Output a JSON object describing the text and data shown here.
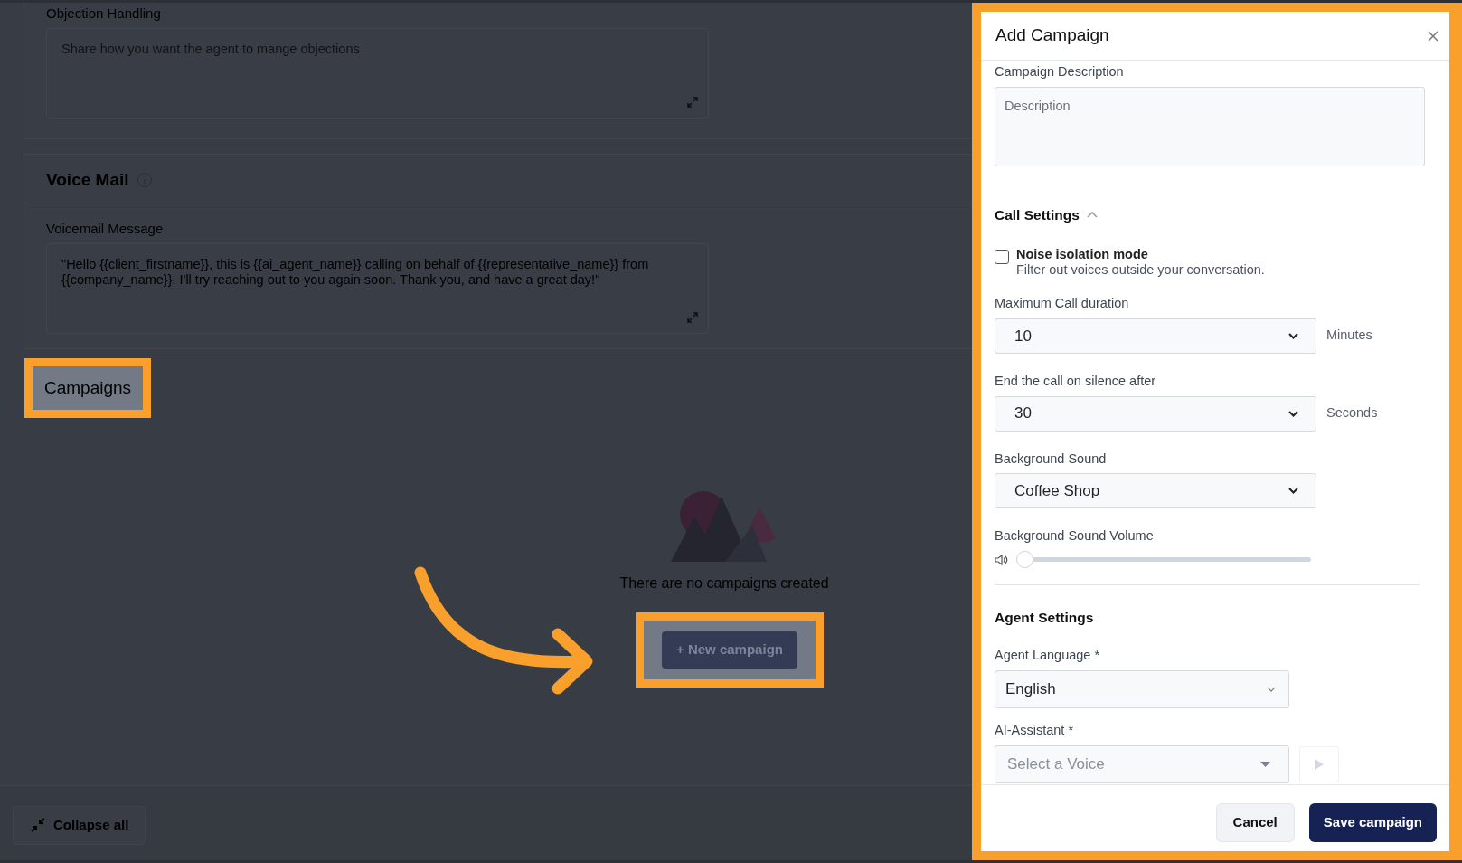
{
  "background_page": {
    "objection_handling": {
      "label": "Objection Handling",
      "placeholder": "Share how you want the agent to mange objections"
    },
    "voice_mail": {
      "title": "Voice Mail",
      "message_label": "Voicemail Message",
      "message": "\"Hello {{client_firstname}}, this is {{ai_agent_name}} calling on behalf of {{representative_name}} from {{company_name}}. I'll try reaching out to you again soon. Thank you, and have a great day!\""
    },
    "campaigns_tab": {
      "label": "Campaigns",
      "highlighted": true
    },
    "empty_state": {
      "message": "There are no campaigns created",
      "button": "+ New campaign",
      "button_highlighted": true
    },
    "collapse_button": "Collapse all"
  },
  "drawer": {
    "title": "Add Campaign",
    "highlighted": true,
    "description": {
      "label": "Campaign Description",
      "placeholder": "Description"
    },
    "call_settings": {
      "title": "Call Settings",
      "expanded": true,
      "noise_isolation": {
        "label": "Noise isolation mode",
        "hint": "Filter out voices outside your conversation.",
        "checked": false
      },
      "max_duration": {
        "label": "Maximum Call duration",
        "value": "10",
        "unit": "Minutes"
      },
      "silence": {
        "label": "End the call on silence after",
        "value": "30",
        "unit": "Seconds"
      },
      "background_sound": {
        "label": "Background Sound",
        "value": "Coffee Shop"
      },
      "volume": {
        "label": "Background Sound Volume",
        "level": 0
      }
    },
    "agent_settings": {
      "title": "Agent Settings",
      "language": {
        "label": "Agent Language *",
        "value": "English"
      },
      "assistant": {
        "label": "AI-Assistant *",
        "placeholder": "Select a Voice"
      }
    },
    "buttons": [
      {
        "label": "Cancel",
        "kind": "secondary"
      },
      {
        "label": "Save campaign",
        "kind": "primary"
      }
    ]
  }
}
